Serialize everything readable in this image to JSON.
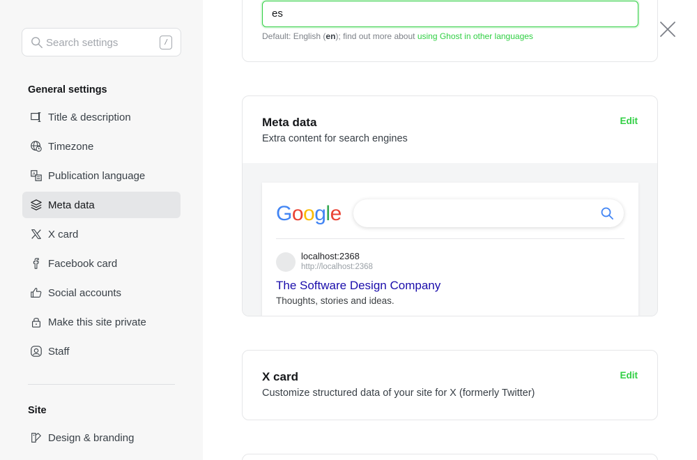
{
  "sidebar": {
    "search_placeholder": "Search settings",
    "search_shortcut": "/",
    "general_title": "General settings",
    "items": [
      {
        "label": "Title & description",
        "icon": "title-icon"
      },
      {
        "label": "Timezone",
        "icon": "globe-clock-icon"
      },
      {
        "label": "Publication language",
        "icon": "translate-icon"
      },
      {
        "label": "Meta data",
        "icon": "layers-icon",
        "active": true
      },
      {
        "label": "X card",
        "icon": "x-logo-icon"
      },
      {
        "label": "Facebook card",
        "icon": "facebook-icon"
      },
      {
        "label": "Social accounts",
        "icon": "thumbs-up-icon"
      },
      {
        "label": "Make this site private",
        "icon": "lock-icon"
      },
      {
        "label": "Staff",
        "icon": "staff-icon"
      }
    ],
    "site_title": "Site",
    "site_items": [
      {
        "label": "Design & branding",
        "icon": "paintbrush-icon"
      }
    ]
  },
  "language": {
    "value": "es",
    "hint_prefix": "Default: English (",
    "hint_code": "en",
    "hint_middle": "); find out more about ",
    "hint_link": "using Ghost in other languages"
  },
  "meta": {
    "title": "Meta data",
    "description": "Extra content for search engines",
    "edit_label": "Edit",
    "preview": {
      "logo": "Google",
      "host": "localhost:2368",
      "url": "http://localhost:2368",
      "site_title": "The Software Design Company",
      "site_description": "Thoughts, stories and ideas."
    }
  },
  "xcard": {
    "title": "X card",
    "description": "Customize structured data of your site for X (formerly Twitter)",
    "edit_label": "Edit"
  },
  "colors": {
    "accent": "#30cf43",
    "sidebar_bg": "#f7f7f7",
    "active_item_bg": "#e5e6e8",
    "serp_title": "#1a0dab"
  }
}
